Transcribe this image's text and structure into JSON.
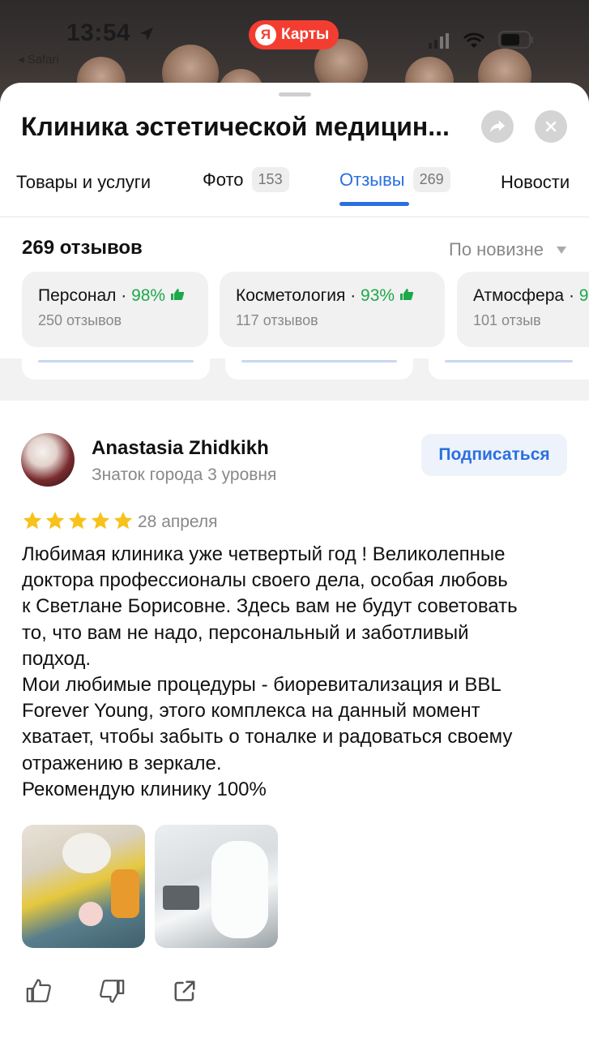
{
  "status_bar": {
    "time": "13:54",
    "back_label": "◂ Safari"
  },
  "app_badge": {
    "logo": "Я",
    "name": "Карты"
  },
  "header": {
    "title": "Клиника эстетической медицин...",
    "share_icon": "share-arrow-icon",
    "close_icon": "close-icon"
  },
  "tabs": [
    {
      "label": "Товары и услуги",
      "count": ""
    },
    {
      "label": "Фото",
      "count": "153"
    },
    {
      "label": "Отзывы",
      "count": "269"
    },
    {
      "label": "Новости",
      "count": ""
    }
  ],
  "active_tab": "Отзывы",
  "reviews": {
    "count_label": "269 отзывов",
    "sort_label": "По новизне"
  },
  "aspects": [
    {
      "name": "Персонал",
      "pct": "98%",
      "sub": "250 отзывов"
    },
    {
      "name": "Косметология",
      "pct": "93%",
      "sub": "117 отзывов"
    },
    {
      "name": "Атмосфера",
      "pct": "9",
      "sub": "101 отзыв"
    }
  ],
  "review": {
    "author": "Anastasia Zhidkikh",
    "author_level": "Знаток города 3 уровня",
    "subscribe_label": "Подписаться",
    "rating": 5,
    "date": "28 апреля",
    "lines": [
      "Любимая клиника уже четвертый год ! Великолепные",
      "доктора профессионалы своего дела, особая любовь",
      "к Светлане Борисовне. Здесь вам не будут советовать",
      "то, что вам не надо, персональный и заботливый",
      "подход.",
      "Мои любимые процедуры - биоревитализация и BBL",
      "Forever Young, этого комплекса на данный момент",
      "хватает, чтобы забыть о тоналке и радоваться своему",
      "отражению в зеркале.",
      "Рекомендую клинику 100%"
    ]
  },
  "colors": {
    "accent": "#2b6fe0",
    "positive": "#1ea84a",
    "brand": "#f43d31",
    "star": "#f6c21b"
  }
}
